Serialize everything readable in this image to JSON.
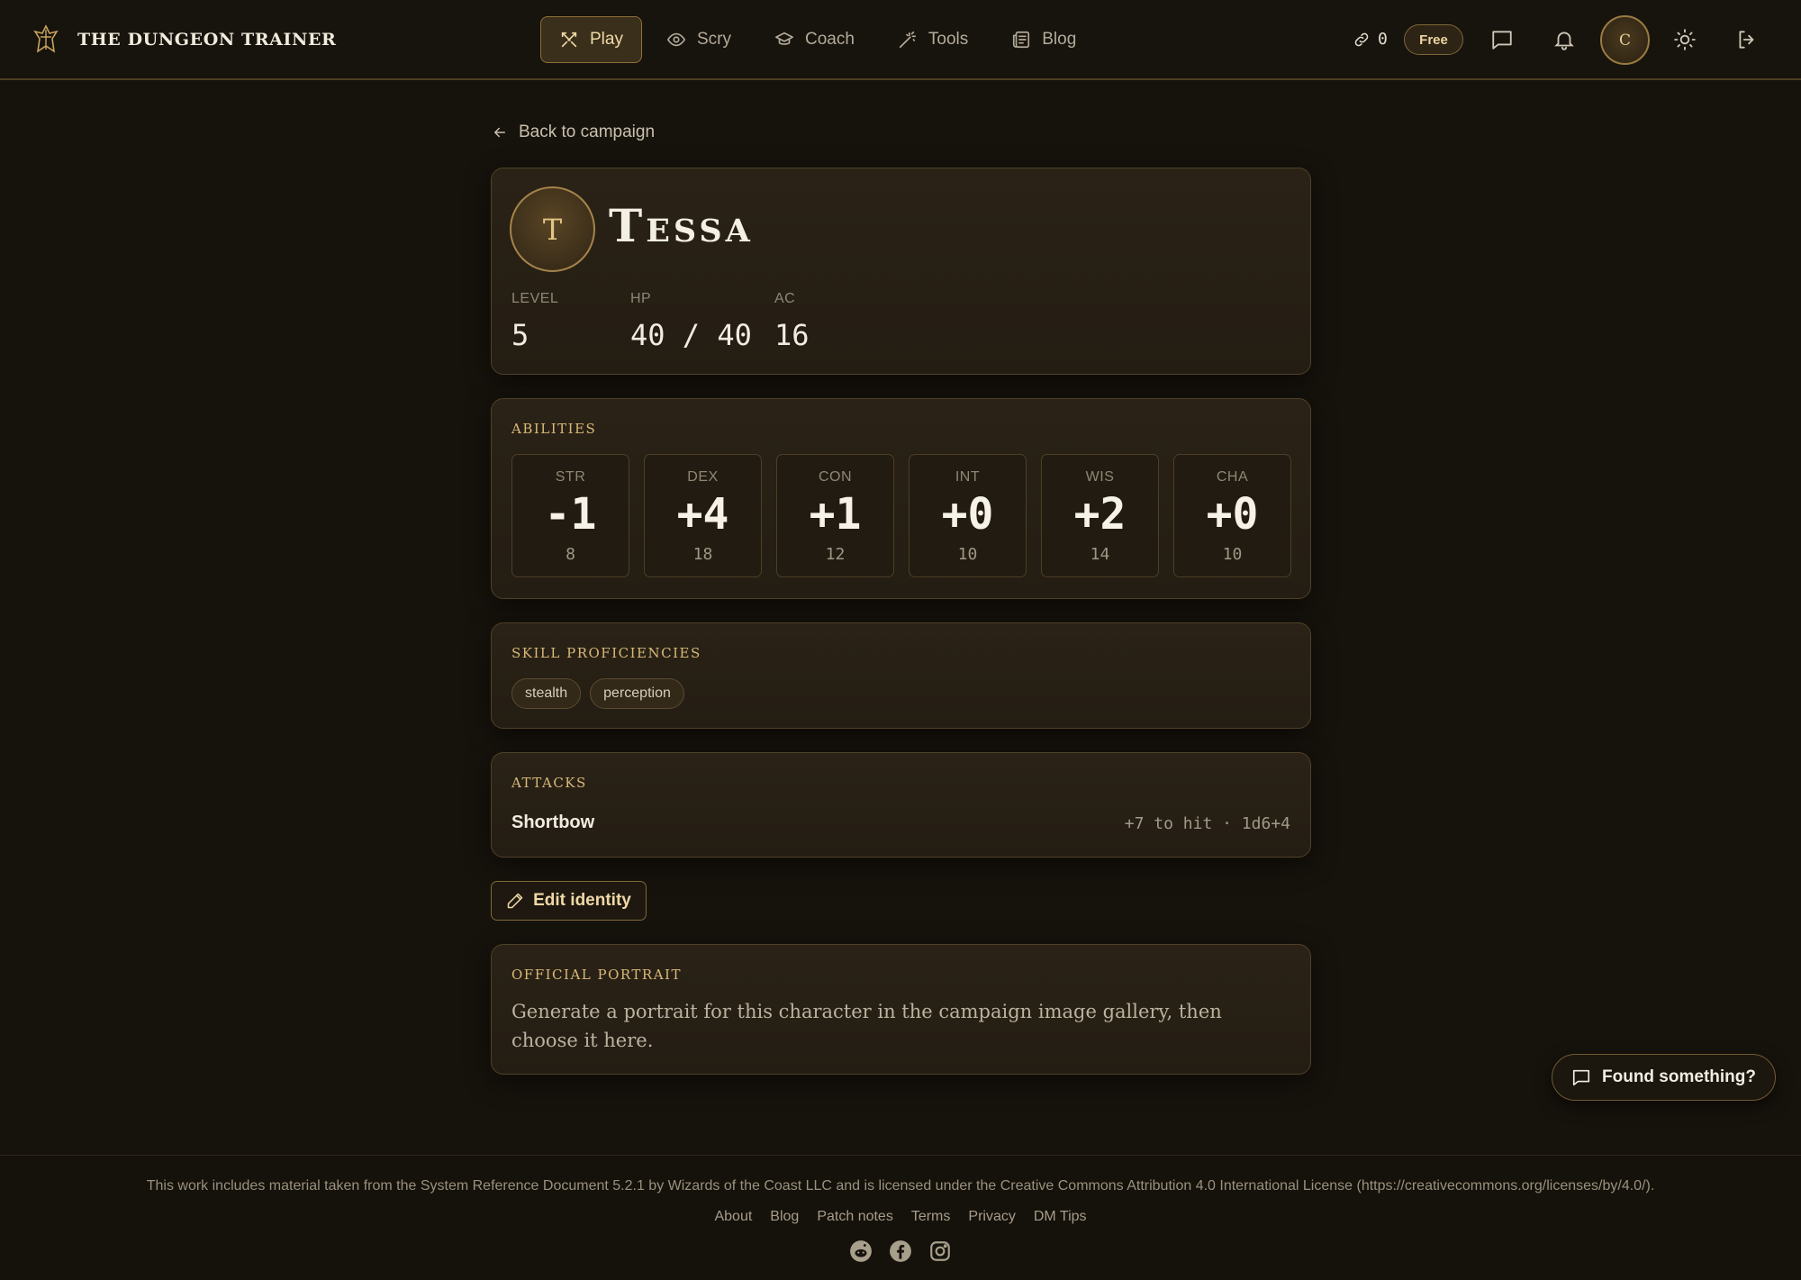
{
  "brand": {
    "name": "THE DUNGEON TRAINER"
  },
  "nav": [
    {
      "label": "Play",
      "icon": "swords-icon",
      "active": true
    },
    {
      "label": "Scry",
      "icon": "eye-icon"
    },
    {
      "label": "Coach",
      "icon": "graduation-cap-icon"
    },
    {
      "label": "Tools",
      "icon": "wand-icon"
    },
    {
      "label": "Blog",
      "icon": "newspaper-icon"
    }
  ],
  "header": {
    "credits": "0",
    "plan": "Free",
    "avatar_initial": "C"
  },
  "back_link": "Back to campaign",
  "character": {
    "initial": "T",
    "name": "Tessa",
    "stats": [
      {
        "label": "LEVEL",
        "value": "5"
      },
      {
        "label": "HP",
        "value": "40 / 40"
      },
      {
        "label": "AC",
        "value": "16"
      }
    ]
  },
  "abilities": {
    "title": "ABILITIES",
    "items": [
      {
        "name": "STR",
        "mod": "-1",
        "score": "8"
      },
      {
        "name": "DEX",
        "mod": "+4",
        "score": "18"
      },
      {
        "name": "CON",
        "mod": "+1",
        "score": "12"
      },
      {
        "name": "INT",
        "mod": "+0",
        "score": "10"
      },
      {
        "name": "WIS",
        "mod": "+2",
        "score": "14"
      },
      {
        "name": "CHA",
        "mod": "+0",
        "score": "10"
      }
    ]
  },
  "skills": {
    "title": "SKILL PROFICIENCIES",
    "items": [
      "stealth",
      "perception"
    ]
  },
  "attacks": {
    "title": "ATTACKS",
    "items": [
      {
        "name": "Shortbow",
        "stats": "+7 to hit · 1d6+4"
      }
    ]
  },
  "edit_button": "Edit identity",
  "portrait": {
    "title": "OFFICIAL PORTRAIT",
    "text": "Generate a portrait for this character in the campaign image gallery, then choose it here."
  },
  "feedback_button": "Found something?",
  "footer": {
    "license": "This work includes material taken from the System Reference Document 5.2.1 by Wizards of the Coast LLC and is licensed under the Creative Commons Attribution 4.0 International License (https://creativecommons.org/licenses/by/4.0/).",
    "links": [
      "About",
      "Blog",
      "Patch notes",
      "Terms",
      "Privacy",
      "DM Tips"
    ],
    "socials": [
      "reddit-icon",
      "facebook-icon",
      "instagram-icon"
    ]
  },
  "colors": {
    "accent": "#d9b978",
    "background": "#16120c",
    "card": "#2a2216",
    "border": "#4f4128"
  }
}
